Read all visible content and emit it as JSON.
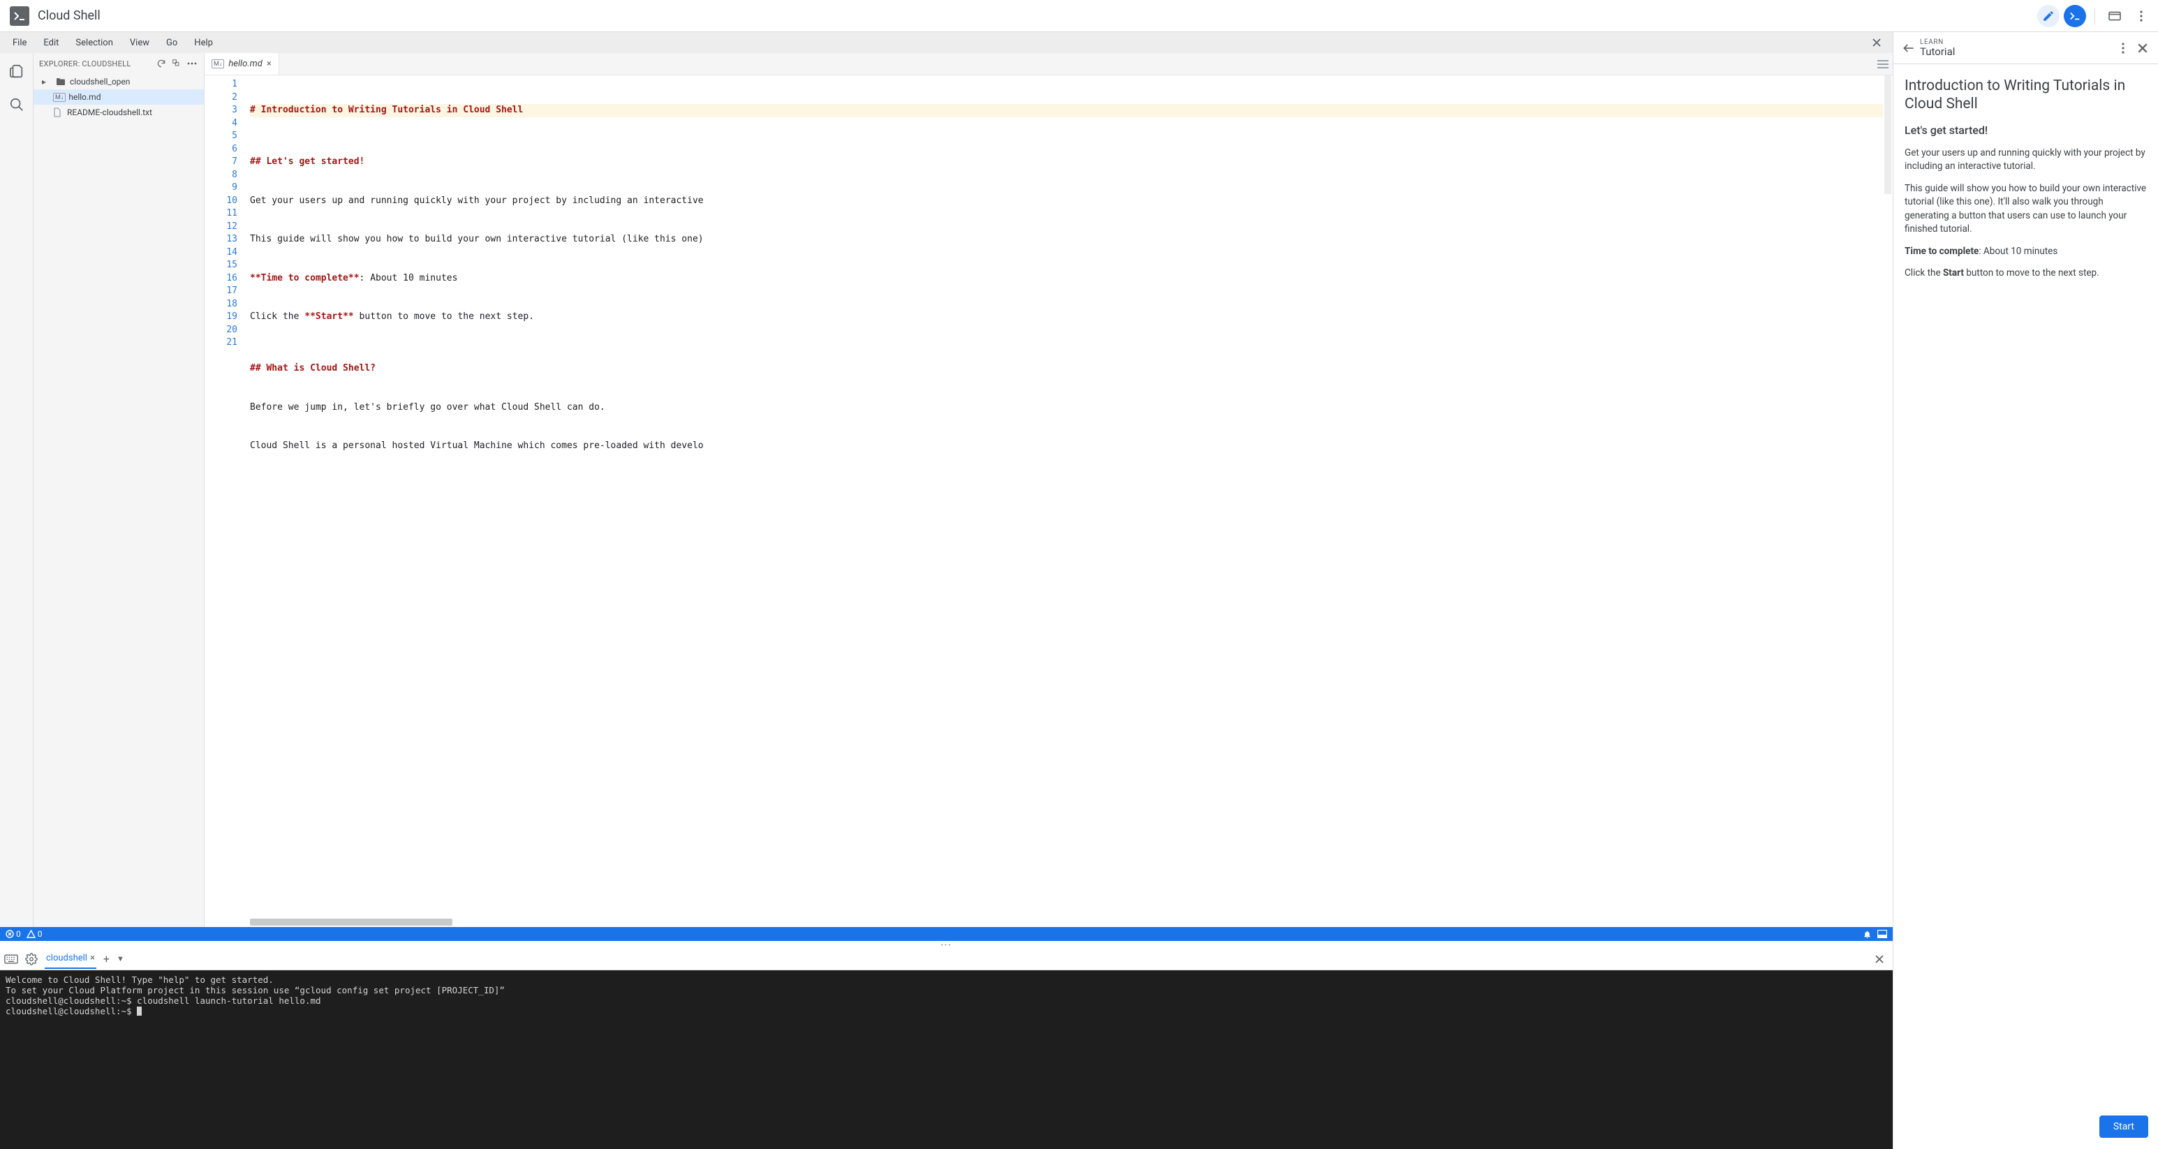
{
  "topbar": {
    "title": "Cloud Shell"
  },
  "menubar": [
    "File",
    "Edit",
    "Selection",
    "View",
    "Go",
    "Help"
  ],
  "explorer": {
    "header": "EXPLORER: CLOUDSHELL",
    "tree": [
      {
        "label": "cloudshell_open",
        "kind": "folder",
        "depth": 0
      },
      {
        "label": "hello.md",
        "kind": "md",
        "depth": 1,
        "selected": true
      },
      {
        "label": "README-cloudshell.txt",
        "kind": "file",
        "depth": 1
      }
    ]
  },
  "openTab": {
    "filename": "hello.md"
  },
  "code": {
    "lines": [
      {
        "n": 1,
        "text": "# Introduction to Writing Tutorials in Cloud Shell",
        "hl": true,
        "highlightRow": true
      },
      {
        "n": 2,
        "text": ""
      },
      {
        "n": 3,
        "text": ""
      },
      {
        "n": 4,
        "text": "## Let's get started!",
        "hl": true
      },
      {
        "n": 5,
        "text": ""
      },
      {
        "n": 6,
        "text": "Get your users up and running quickly with your project by including an interactive"
      },
      {
        "n": 7,
        "text": ""
      },
      {
        "n": 8,
        "text": "This guide will show you how to build your own interactive tutorial (like this one)"
      },
      {
        "n": 9,
        "text": ""
      },
      {
        "n": 10,
        "text": "**Time to complete**: About 10 minutes",
        "boldLead": "**Time to complete**"
      },
      {
        "n": 11,
        "text": ""
      },
      {
        "n": 12,
        "text": "Click the **Start** button to move to the next step.",
        "boldMid": "**Start**"
      },
      {
        "n": 13,
        "text": ""
      },
      {
        "n": 14,
        "text": ""
      },
      {
        "n": 15,
        "text": "## What is Cloud Shell?",
        "hl": true
      },
      {
        "n": 16,
        "text": ""
      },
      {
        "n": 17,
        "text": "Before we jump in, let's briefly go over what Cloud Shell can do."
      },
      {
        "n": 18,
        "text": ""
      },
      {
        "n": 19,
        "text": "Cloud Shell is a personal hosted Virtual Machine which comes pre-loaded with develo"
      },
      {
        "n": 20,
        "text": ""
      },
      {
        "n": 21,
        "text": ""
      }
    ]
  },
  "statusbar": {
    "errors": "0",
    "warnings": "0"
  },
  "terminalTab": "cloudshell",
  "terminal": {
    "lines": [
      "Welcome to Cloud Shell! Type \"help\" to get started.",
      "To set your Cloud Platform project in this session use “gcloud config set project [PROJECT_ID]”",
      "cloudshell@cloudshell:~$ cloudshell launch-tutorial hello.md",
      "cloudshell@cloudshell:~$ "
    ]
  },
  "tutorial": {
    "eyebrow": "LEARN",
    "title": "Tutorial",
    "h1": "Introduction to Writing Tutorials in Cloud Shell",
    "h2": "Let's get started!",
    "p1": "Get your users up and running quickly with your project by including an interactive tutorial.",
    "p2": "This guide will show you how to build your own interactive tutorial (like this one). It'll also walk you through generating a button that users can use to launch your finished tutorial.",
    "timeLabel": "Time to complete",
    "timeValue": ": About 10 minutes",
    "p4a": "Click the ",
    "p4b": "Start",
    "p4c": " button to move to the next step.",
    "startBtn": "Start"
  }
}
